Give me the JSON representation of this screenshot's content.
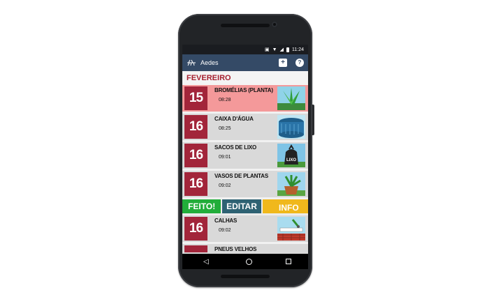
{
  "statusbar": {
    "time": "11:24"
  },
  "appbar": {
    "title": "Aedes"
  },
  "month": "FEVEREIRO",
  "items": [
    {
      "day": "15",
      "name": "BROMÉLIAS (PLANTA)",
      "time": "08:28",
      "icon": "bromeliad-icon"
    },
    {
      "day": "16",
      "name": "CAIXA D'ÁGUA",
      "time": "08:25",
      "icon": "water-tank-icon"
    },
    {
      "day": "16",
      "name": "SACOS DE LIXO",
      "time": "09:01",
      "icon": "trash-bag-icon",
      "badge": "LIXO"
    },
    {
      "day": "16",
      "name": "VASOS DE PLANTAS",
      "time": "09:02",
      "icon": "plant-pot-icon"
    },
    {
      "day": "16",
      "name": "CALHAS",
      "time": "09:02",
      "icon": "gutter-icon"
    },
    {
      "day": "",
      "name": "PNEUS VELHOS",
      "time": "",
      "icon": "tire-icon"
    }
  ],
  "actions": {
    "done": "FEITO!",
    "edit": "EDITAR",
    "info": "INFO"
  },
  "colors": {
    "appbar": "#344a66",
    "day_badge": "#a2253a",
    "highlight": "#f4999a",
    "done": "#22ad3a",
    "edit": "#2e6273",
    "info": "#f0b81c"
  }
}
